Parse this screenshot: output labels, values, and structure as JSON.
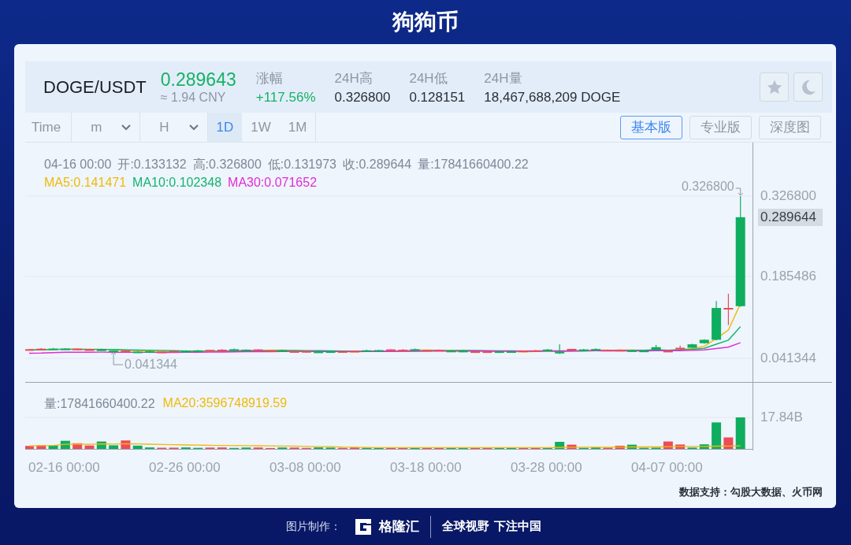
{
  "title": "狗狗币",
  "ticker": {
    "pair": "DOGE/USDT",
    "price": "0.289643",
    "cny": "≈ 1.94 CNY",
    "stats": [
      {
        "label": "涨幅",
        "value": "+117.56%",
        "kind": "change"
      },
      {
        "label": "24H高",
        "value": "0.326800",
        "kind": "plain"
      },
      {
        "label": "24H低",
        "value": "0.128151",
        "kind": "plain"
      },
      {
        "label": "24H量",
        "value": "18,467,688,209 DOGE",
        "kind": "plain"
      }
    ]
  },
  "intervals": [
    {
      "label": "Time",
      "kind": "plain",
      "selected": false
    },
    {
      "label": "m",
      "kind": "dropdown",
      "selected": false
    },
    {
      "label": "H",
      "kind": "dropdown",
      "selected": false
    },
    {
      "label": "1D",
      "kind": "plain",
      "selected": true
    },
    {
      "label": "1W",
      "kind": "plain",
      "selected": false
    },
    {
      "label": "1M",
      "kind": "plain",
      "selected": false
    }
  ],
  "views": [
    {
      "label": "基本版",
      "selected": true
    },
    {
      "label": "专业版",
      "selected": false
    },
    {
      "label": "深度图",
      "selected": false
    }
  ],
  "candle_info": {
    "date": "04-16 00:00",
    "fields": [
      "开:0.133132",
      "高:0.326800",
      "低:0.131973",
      "收:0.289644",
      "量:17841660400.22"
    ]
  },
  "ma": [
    {
      "label": "MA5:0.141471",
      "color": "#f0b90b"
    },
    {
      "label": "MA10:0.102348",
      "color": "#14b46e"
    },
    {
      "label": "MA30:0.071652",
      "color": "#e22bd6"
    }
  ],
  "high_marker": "0.326800",
  "low_marker": "0.041344",
  "price_axis": [
    {
      "label": "0.326800",
      "kind": "tick"
    },
    {
      "label": "0.289644",
      "kind": "current"
    },
    {
      "label": "0.185486",
      "kind": "tick"
    },
    {
      "label": "0.041344",
      "kind": "tick"
    }
  ],
  "volume_info": {
    "volume": "量:17841660400.22",
    "ma": [
      {
        "label": "MA20:3596748919.59",
        "color": "#f0b90b"
      }
    ]
  },
  "volume_axis": "17.84B",
  "time_axis": [
    "02-16 00:00",
    "02-26 00:00",
    "03-08 00:00",
    "03-18 00:00",
    "03-28 00:00",
    "04-07 00:00"
  ],
  "source": "数据支持：勾股大数据、火币网",
  "footer": {
    "credit": "图片制作：",
    "logo": "格隆汇",
    "slogan": "全球视野 下注中国"
  }
}
